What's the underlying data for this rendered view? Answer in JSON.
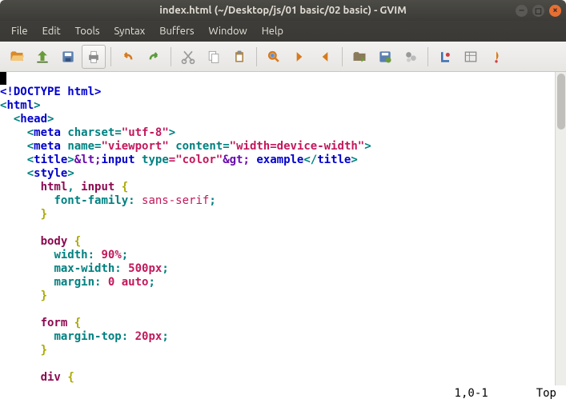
{
  "titlebar": {
    "title": "index.html (~/Desktop/js/01 basic/02 basic) - GVIM"
  },
  "menubar": {
    "items": [
      "File",
      "Edit",
      "Tools",
      "Syntax",
      "Buffers",
      "Window",
      "Help"
    ]
  },
  "toolbar_icons": [
    "open-icon",
    "save-icon",
    "save-all-icon",
    "print-icon",
    "sep",
    "undo-icon",
    "redo-icon",
    "sep",
    "cut-icon",
    "copy-icon",
    "paste-icon",
    "sep",
    "find-replace-icon",
    "find-next-icon",
    "find-prev-icon",
    "sep",
    "session-load-icon",
    "session-save-icon",
    "run-script-icon",
    "sep",
    "make-icon",
    "shell-icon",
    "tags-icon"
  ],
  "code": {
    "l1": "<!DOCTYPE html>",
    "l2a": "<",
    "l2b": "html",
    "l2c": ">",
    "l3a": "  <",
    "l3b": "head",
    "l3c": ">",
    "l4a": "    <",
    "l4b": "meta",
    "l4c": " ",
    "l4d": "charset",
    "l4e": "=",
    "l4f": "\"utf-8\"",
    "l4g": ">",
    "l5a": "    <",
    "l5b": "meta",
    "l5c": " ",
    "l5d": "name",
    "l5e": "=",
    "l5f": "\"viewport\"",
    "l5g": " ",
    "l5h": "content",
    "l5i": "=",
    "l5j": "\"width=device-width\"",
    "l5k": ">",
    "l6a": "    <",
    "l6b": "title",
    "l6c": ">",
    "l6d": "&lt;",
    "l6e": "input ",
    "l6f": "type",
    "l6g": "=\"color\"",
    "l6h": "&gt;",
    "l6i": " example",
    "l6j": "</",
    "l6k": "title",
    "l6l": ">",
    "l7a": "    <",
    "l7b": "style",
    "l7c": ">",
    "l8a": "      ",
    "l8b": "html",
    "l8c": ", ",
    "l8d": "input",
    "l8e": " ",
    "l8f": "{",
    "l9a": "        ",
    "l9b": "font-family",
    "l9c": ": ",
    "l9d": "sans-serif",
    "l9e": ";",
    "l10": "      ",
    "l10b": "}",
    "l11": "",
    "l12a": "      ",
    "l12b": "body",
    "l12c": " ",
    "l12d": "{",
    "l13a": "        ",
    "l13b": "width",
    "l13c": ": ",
    "l13d": "90",
    "l13e": "%",
    "l13f": ";",
    "l14a": "        ",
    "l14b": "max-width",
    "l14c": ": ",
    "l14d": "500",
    "l14e": "px",
    "l14f": ";",
    "l15a": "        ",
    "l15b": "margin",
    "l15c": ": ",
    "l15d": "0",
    "l15e": " ",
    "l15f": "auto",
    "l15g": ";",
    "l16": "      ",
    "l16b": "}",
    "l17": "",
    "l18a": "      ",
    "l18b": "form",
    "l18c": " ",
    "l18d": "{",
    "l19a": "        ",
    "l19b": "margin-top",
    "l19c": ": ",
    "l19d": "20",
    "l19e": "px",
    "l19f": ";",
    "l20": "      ",
    "l20b": "}",
    "l21": "",
    "l22a": "      ",
    "l22b": "div",
    "l22c": " ",
    "l22d": "{"
  },
  "status": {
    "pos": "1,0-1",
    "loc": "Top"
  }
}
